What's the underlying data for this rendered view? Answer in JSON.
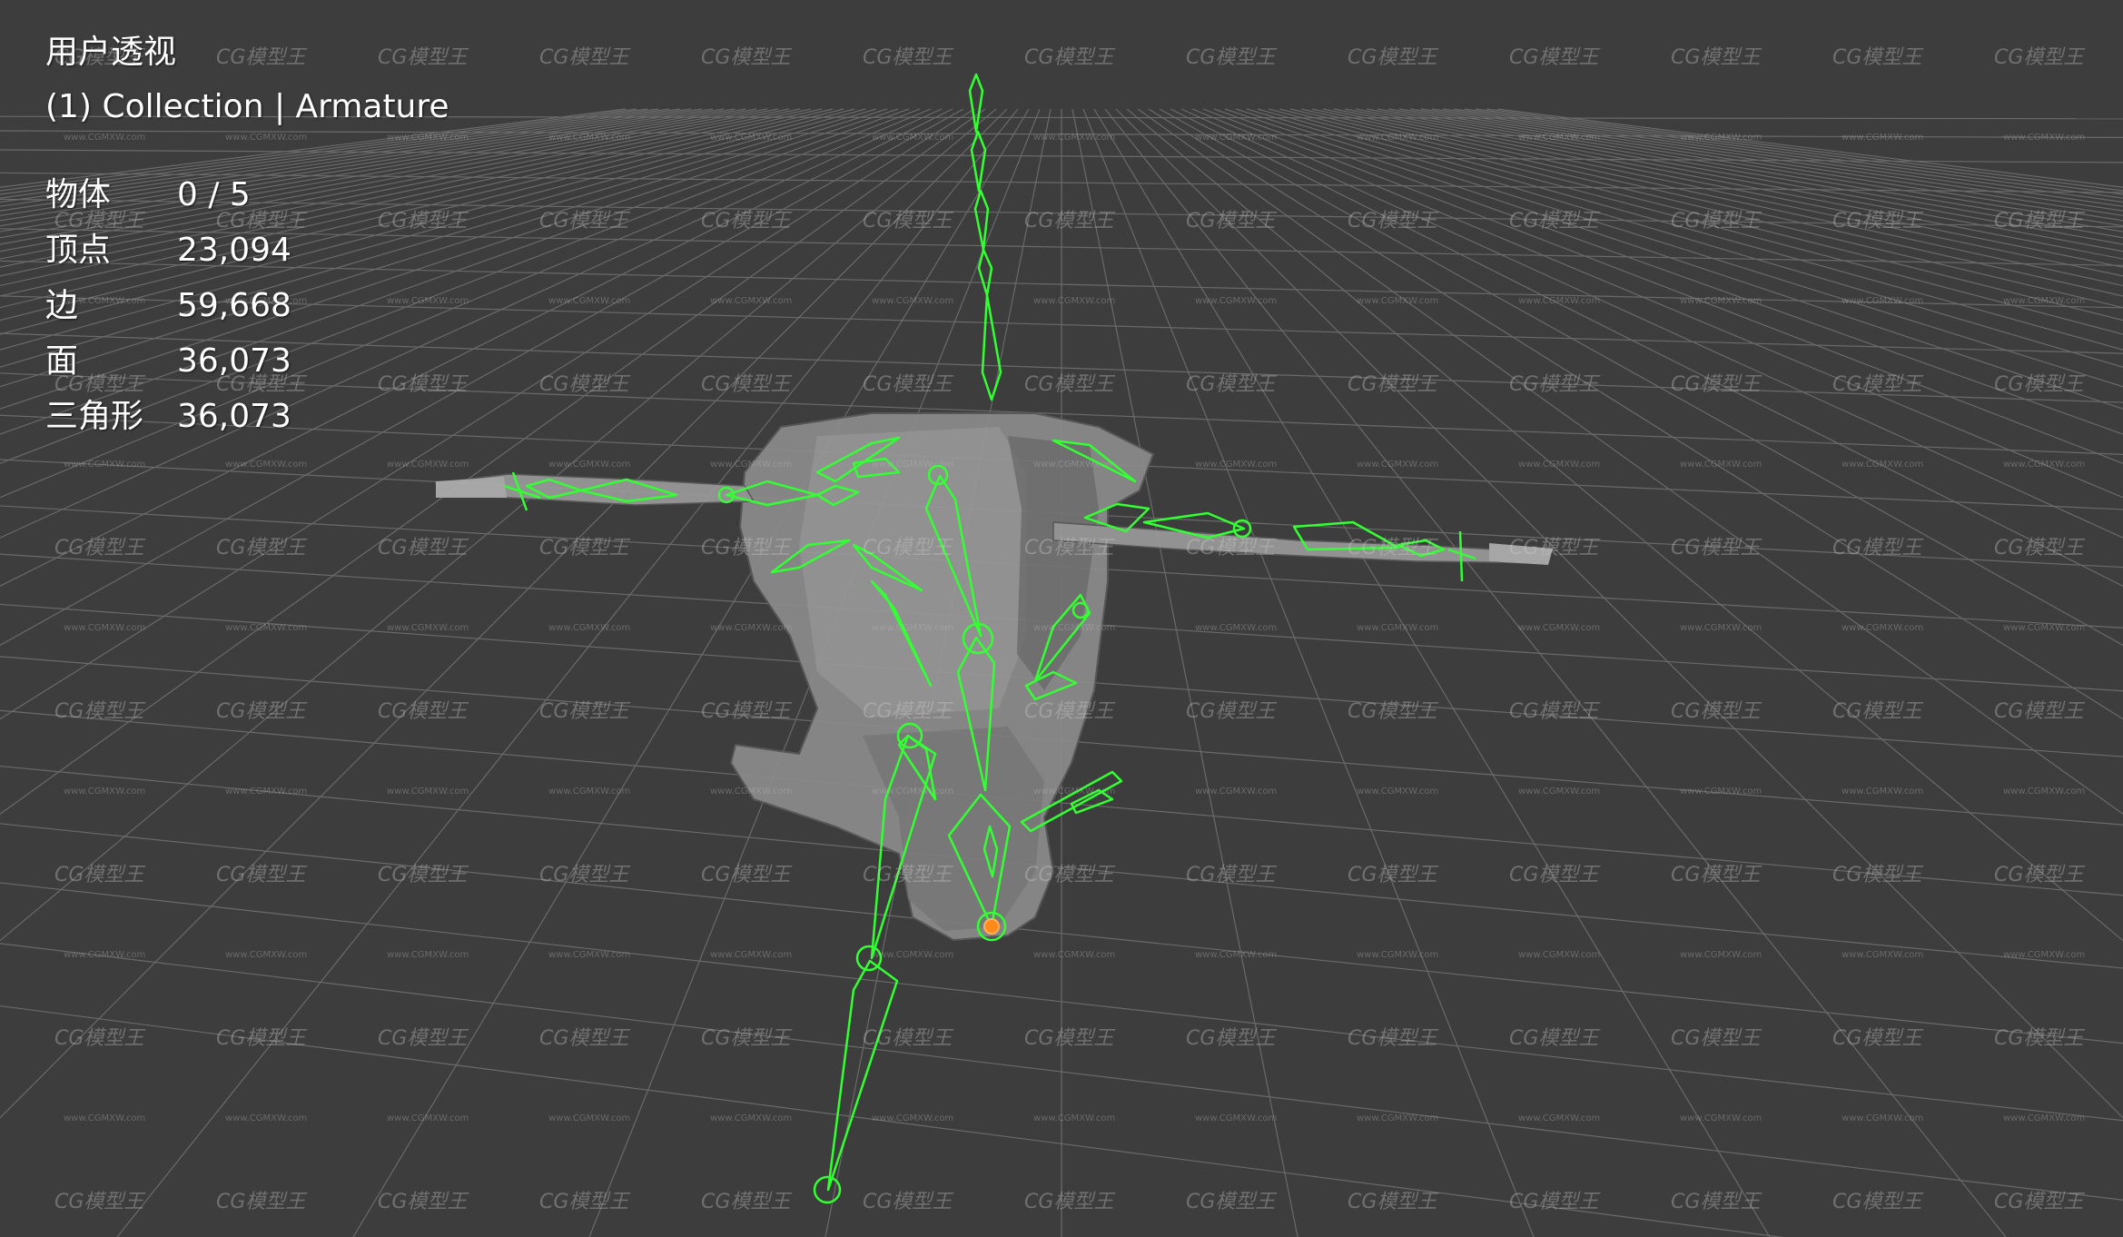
{
  "viewport": {
    "view_name": "用户透视",
    "collection_line": "(1) Collection | Armature",
    "stats": [
      {
        "label": "物体",
        "value": "0 / 5"
      },
      {
        "label": "顶点",
        "value": "23,094"
      },
      {
        "label": "边",
        "value": "59,668"
      },
      {
        "label": "面",
        "value": "36,073"
      },
      {
        "label": "三角形",
        "value": "36,073"
      }
    ]
  },
  "watermark": {
    "logo_text": "CG模型王",
    "url_text": "www.CGMXW.com"
  },
  "colors": {
    "background": "#3d3d3d",
    "grid_line": "#6a6a6a",
    "bone": "#33ff33",
    "active_joint": "#ff8a1a",
    "mesh": "#8a8a8a"
  }
}
